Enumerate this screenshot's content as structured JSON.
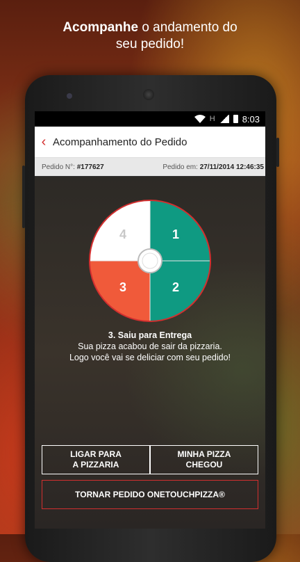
{
  "headline": {
    "bold": "Acompanhe",
    "rest": " o andamento do",
    "line2": "seu pedido!"
  },
  "statusbar": {
    "network": "H",
    "time": "8:03"
  },
  "appbar": {
    "title": "Acompanhamento do Pedido"
  },
  "order": {
    "number_label": "Pedido N°:",
    "number_value": "#177627",
    "date_label": "Pedido em:",
    "date_value": "27/11/2014 12:46:35"
  },
  "tracker": {
    "current_step": 3,
    "segments": [
      {
        "label": "1",
        "color": "#0f9a82"
      },
      {
        "label": "2",
        "color": "#0f9a82"
      },
      {
        "label": "3",
        "color": "#f05a3a"
      },
      {
        "label": "4",
        "color": "#ffffff"
      }
    ],
    "step_title": "3. Saiu para Entrega",
    "step_line1": "Sua pizza acabou de sair da pizzaria.",
    "step_line2": "Logo você vai se deliciar com seu pedido!"
  },
  "buttons": {
    "call_line1": "LIGAR PARA",
    "call_line2": "A PIZZARIA",
    "arrived_line1": "MINHA PIZZA",
    "arrived_line2": "CHEGOU",
    "onetouch": "TORNAR PEDIDO ONETOUCHPIZZA®"
  },
  "colors": {
    "accent": "#d32f2f",
    "teal": "#0f9a82",
    "orange": "#f05a3a"
  }
}
